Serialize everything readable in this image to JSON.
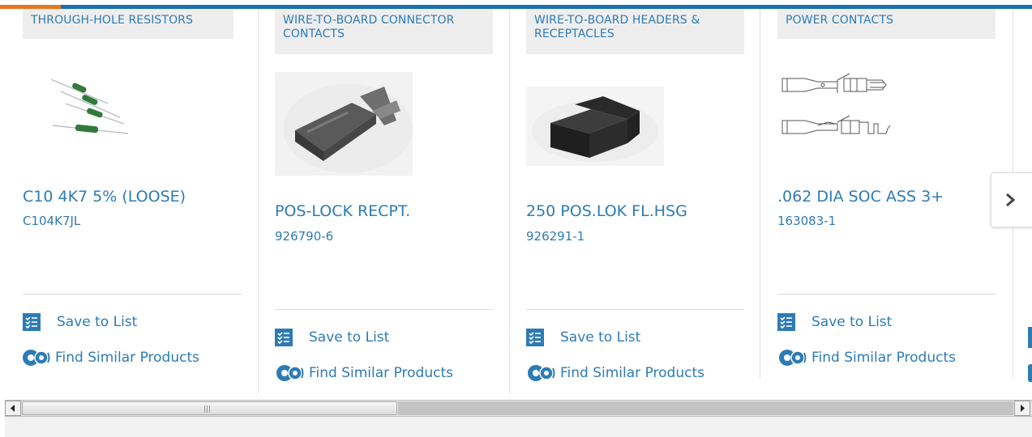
{
  "carousel": {
    "products": [
      {
        "category": "THROUGH-HOLE RESISTORS",
        "name": "C10 4K7 5% (LOOSE)",
        "part_number": "C104K7JL",
        "image_icon": "resistor-image"
      },
      {
        "category": "WIRE-TO-BOARD CONNECTOR CONTACTS",
        "name": "POS-LOCK RECPT.",
        "part_number": "926790-6",
        "image_icon": "contact-image"
      },
      {
        "category": "WIRE-TO-BOARD HEADERS & RECEPTACLES",
        "name": "250 POS.LOK FL.HSG",
        "part_number": "926291-1",
        "image_icon": "housing-image"
      },
      {
        "category": "POWER CONTACTS",
        "name": ".062 DIA SOC ASS 3+",
        "part_number": "163083-1",
        "image_icon": "power-contact-drawing"
      }
    ],
    "save_label": "Save to List",
    "similar_label": "Find Similar Products",
    "next_icon": "chevron-right-icon"
  },
  "colors": {
    "link": "#2e7bb4",
    "top_bar": "#1a6faf",
    "top_accent": "#e87722"
  }
}
